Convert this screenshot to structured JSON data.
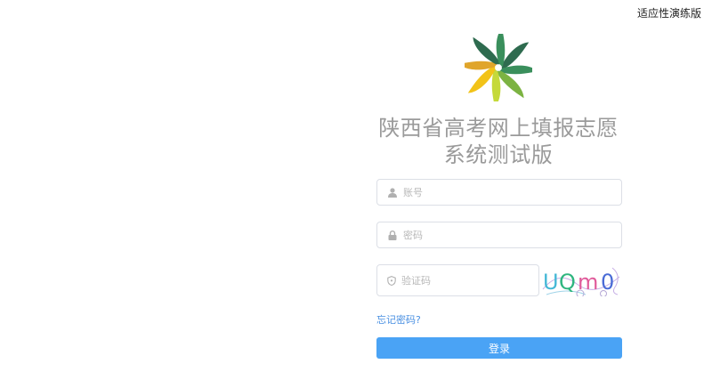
{
  "header": {
    "version_label": "适应性演练版"
  },
  "brand": {
    "title_line1": "陕西省高考网上填报志愿",
    "title_line2": "系统测试版",
    "logo_colors": [
      "#2e6b4f",
      "#3a8f5c",
      "#7cb342",
      "#c5d93a",
      "#f2c318",
      "#e0a52b"
    ]
  },
  "form": {
    "username_placeholder": "账号",
    "password_placeholder": "密码",
    "captcha_placeholder": "验证码",
    "captcha_text": "UQm0",
    "forgot_label": "忘记密码?",
    "login_label": "登录"
  },
  "colors": {
    "primary": "#4aa3f5",
    "link": "#4a90e2",
    "title": "#9a9a9a"
  }
}
